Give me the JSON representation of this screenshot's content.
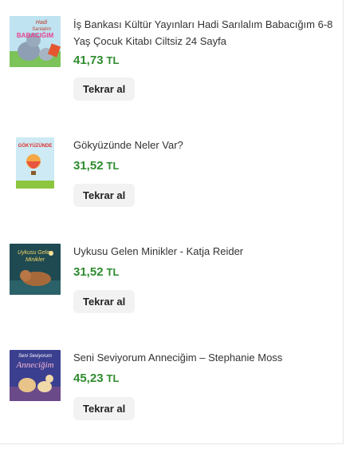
{
  "items": [
    {
      "title": "İş Bankası Kültür Yayınları Hadi Sarılalım Babacığım 6-8 Yaş Çocuk Kitabı Ciltsiz 24 Sayfa",
      "price": "41,73",
      "currency": "TL",
      "button": "Tekrar al",
      "cover_text": "Hadi Sarılalım BABACIĞIM",
      "cover_icon": "elephant-book-cover"
    },
    {
      "title": "Gökyüzünde Neler Var?",
      "price": "31,52",
      "currency": "TL",
      "button": "Tekrar al",
      "cover_text": "GÖKYÜZÜNDE",
      "cover_icon": "hot-air-balloon-book-cover"
    },
    {
      "title": "Uykusu Gelen Minikler - Katja Reider",
      "price": "31,52",
      "currency": "TL",
      "button": "Tekrar al",
      "cover_text": "Uykusu Gelen Minikler",
      "cover_icon": "sleeping-otter-book-cover"
    },
    {
      "title": "Seni Seviyorum Anneciğim – Stephanie Moss",
      "price": "45,23",
      "currency": "TL",
      "button": "Tekrar al",
      "cover_text": "Seni Seviyorum Anneciğim",
      "cover_icon": "horses-book-cover"
    }
  ],
  "colors": {
    "price": "#2e8b2e",
    "button_bg": "#f2f2f2",
    "text": "#333333"
  }
}
